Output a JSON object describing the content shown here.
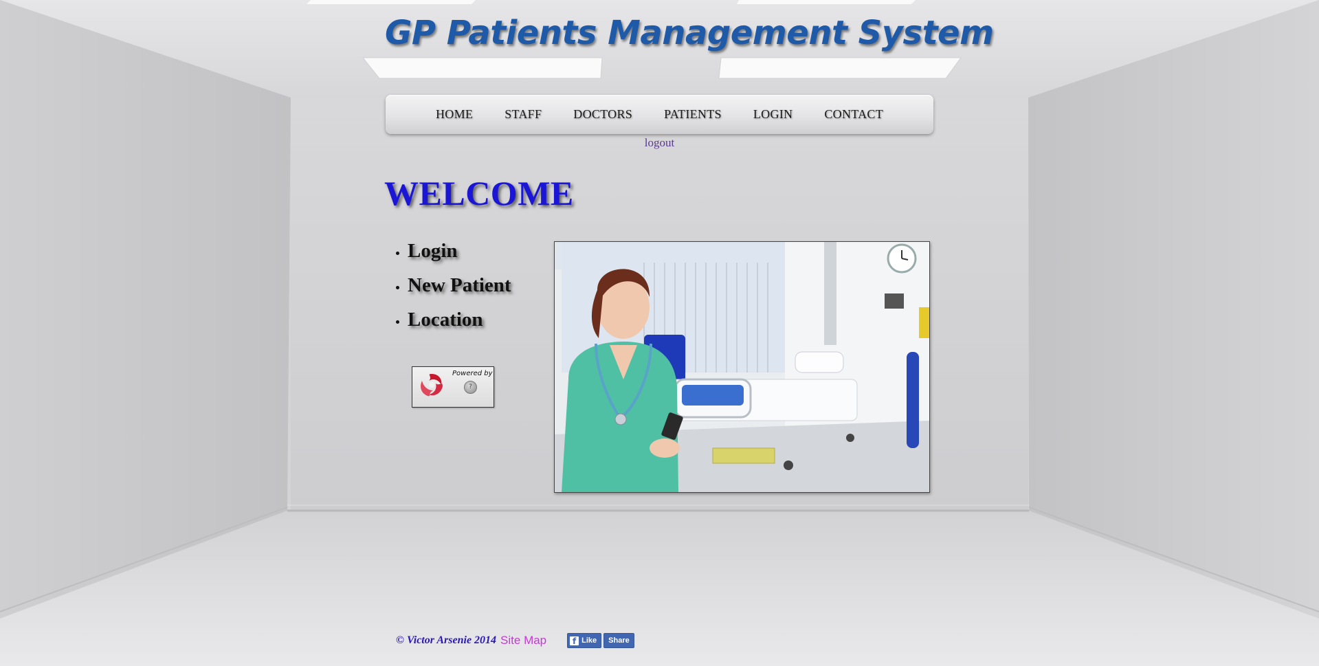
{
  "header": {
    "title": "GP Patients Management System"
  },
  "nav": {
    "items": [
      {
        "label": "HOME"
      },
      {
        "label": "STAFF"
      },
      {
        "label": "DOCTORS"
      },
      {
        "label": "PATIENTS"
      },
      {
        "label": "LOGIN"
      },
      {
        "label": "CONTACT"
      }
    ],
    "logout_label": "logout"
  },
  "main": {
    "heading": "WELCOME",
    "links": [
      {
        "label": "Login"
      },
      {
        "label": "New Patient"
      },
      {
        "label": "Location"
      }
    ],
    "powered_by": "Powered by"
  },
  "footer": {
    "copyright": "© Victor Arsenie 2014",
    "sitemap": "Site Map",
    "fb_like": "Like",
    "fb_share": "Share"
  },
  "colors": {
    "title": "#1f5aa8",
    "welcome": "#1b16d6",
    "copyright": "#2a17b8",
    "sitemap": "#c23ad0",
    "logout": "#5a3a8c",
    "facebook": "#4267b2"
  }
}
